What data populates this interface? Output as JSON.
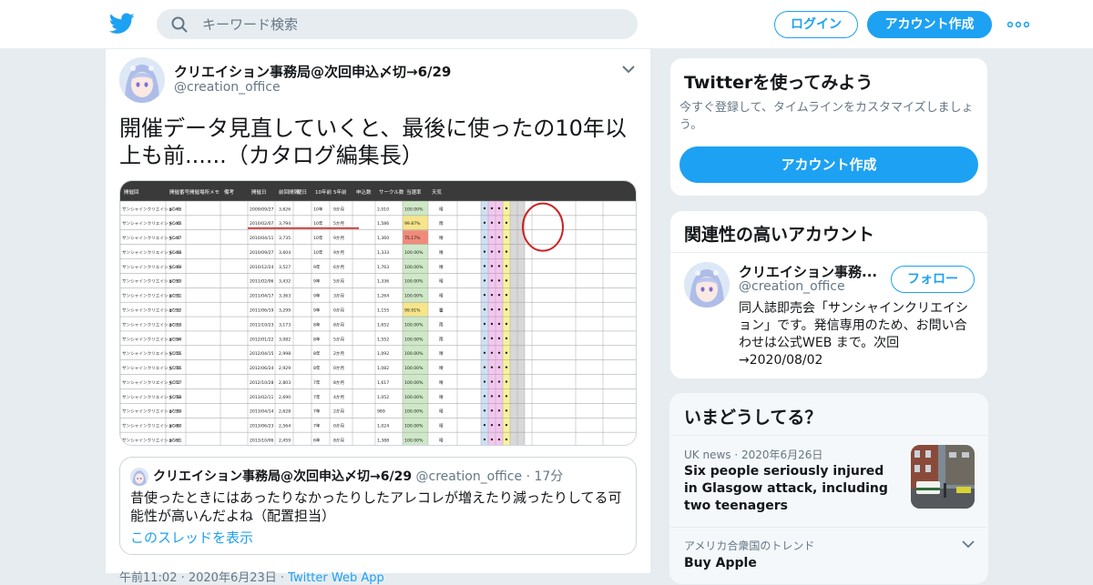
{
  "header": {
    "search_placeholder": "キーワード検索",
    "login_label": "ログイン",
    "signup_label": "アカウント作成",
    "brand_color": "#1da1f2"
  },
  "tweet": {
    "author_name": "クリエイション事務局@次回申込〆切→6/29",
    "author_handle": "@creation_office",
    "text": "開催データ見直していくと、最後に使ったの10年以上も前......（カタログ編集長）",
    "quote": {
      "author_name": "クリエイション事務局@次回申込〆切→6/29",
      "author_handle": "@creation_office",
      "time": "17分",
      "text": "昔使ったときにはあったりなかったりしたアレコレが増えたり減ったりしてる可能性が高いんだよね（配置担当）",
      "thread_link": "このスレッドを表示"
    },
    "timestamp": "午前11:02 · 2020年6月23日 · ",
    "source": "Twitter Web App"
  },
  "signup_card": {
    "title": "Twitterを使ってみよう",
    "subtitle": "今すぐ登録して、タイムラインをカスタマイズしましょう。",
    "button_label": "アカウント作成"
  },
  "related_card": {
    "title": "関連性の高いアカウント",
    "name": "クリエイション事務...",
    "handle": "@creation_office",
    "follow_label": "フォロー",
    "bio": "同人誌即売会「サンシャインクリエイション」です。発信専用のため、お問い合わせは公式WEB まで。次回→2020/08/02"
  },
  "trends_card": {
    "title": "いまどうしてる？",
    "news_meta": "UK news · 2020年6月26日",
    "news_headline": "Six people seriously injured in Glasgow attack, including two teenagers",
    "trend_meta": "アメリカ合衆国のトレンド",
    "trend_name": "Buy Apple"
  },
  "spreadsheet": {
    "headers": [
      "開催回",
      "開催番号",
      "開催場所メモ",
      "備考",
      "開催日",
      "前回間隔",
      "曜日",
      "10年前",
      "5年前",
      "申込数",
      "サークル数",
      "当選率",
      "天気"
    ],
    "rows": [
      [
        "サンシャインクリエイション45",
        "SC45",
        "2009/09/27",
        "3,626",
        "10年",
        "9か月",
        "2,010",
        "100.00%",
        "晴"
      ],
      [
        "サンシャインクリエイション46",
        "SC46",
        "2010/02/07",
        "3,794",
        "10年",
        "5か月",
        "1,586",
        "99.87%",
        "雨"
      ],
      [
        "サンシャインクリエイション47",
        "SC47",
        "2010/04/11",
        "3,735",
        "10年",
        "9か月",
        "1,360",
        "75.17%",
        "晴"
      ],
      [
        "サンシャインクリエイション48",
        "SC48",
        "2010/09/27",
        "3,604",
        "10年",
        "9か月",
        "1,333",
        "100.00%",
        "晴"
      ],
      [
        "サンシャインクリエイション49",
        "SC49",
        "2010/12/24",
        "3,527",
        "9年",
        "6か月",
        "1,763",
        "100.00%",
        "晴"
      ],
      [
        "サンシャインクリエイション50",
        "SC50",
        "2011/02/06",
        "3,432",
        "9年",
        "5か月",
        "1,336",
        "100.00%",
        "晴"
      ],
      [
        "サンシャインクリエイション51",
        "SC51",
        "2011/04/17",
        "3,363",
        "9年",
        "3か月",
        "1,264",
        "100.00%",
        "晴"
      ],
      [
        "サンシャインクリエイション52",
        "SC52",
        "2011/06/19",
        "3,299",
        "9年",
        "0か月",
        "1,155",
        "99.91%",
        "曇"
      ],
      [
        "サンシャインクリエイション53",
        "SC53",
        "2011/10/23",
        "3,173",
        "8年",
        "8か月",
        "1,652",
        "100.00%",
        "雨"
      ],
      [
        "サンシャインクリエイション54",
        "SC54",
        "2012/01/22",
        "3,082",
        "8年",
        "5か月",
        "1,552",
        "100.00%",
        "雨"
      ],
      [
        "サンシャインクリエイション55",
        "SC55",
        "2012/04/15",
        "2,998",
        "8年",
        "2か月",
        "1,092",
        "100.00%",
        "晴"
      ],
      [
        "サンシャインクリエイション56",
        "SC56",
        "2012/06/24",
        "2,929",
        "8年",
        "0か月",
        "1,082",
        "100.00%",
        "晴"
      ],
      [
        "サンシャインクリエイション57",
        "SC57",
        "2012/10/28",
        "2,803",
        "7年",
        "8か月",
        "1,617",
        "100.00%",
        "晴"
      ],
      [
        "サンシャインクリエイション58",
        "SC58",
        "2013/02/11",
        "2,690",
        "7年",
        "4か月",
        "1,052",
        "100.00%",
        "晴"
      ],
      [
        "サンシャインクリエイション59",
        "SC59",
        "2013/04/14",
        "2,628",
        "7年",
        "2か月",
        "989",
        "100.00%",
        "晴"
      ],
      [
        "サンシャインクリエイション60",
        "SC60",
        "2013/06/23",
        "2,564",
        "7年",
        "0か月",
        "1,024",
        "100.00%",
        "晴"
      ],
      [
        "サンシャインクリエイション61",
        "SC61",
        "2013/10/06",
        "2,459",
        "6年",
        "8か月",
        "1,388",
        "100.00%",
        "晴"
      ]
    ]
  }
}
